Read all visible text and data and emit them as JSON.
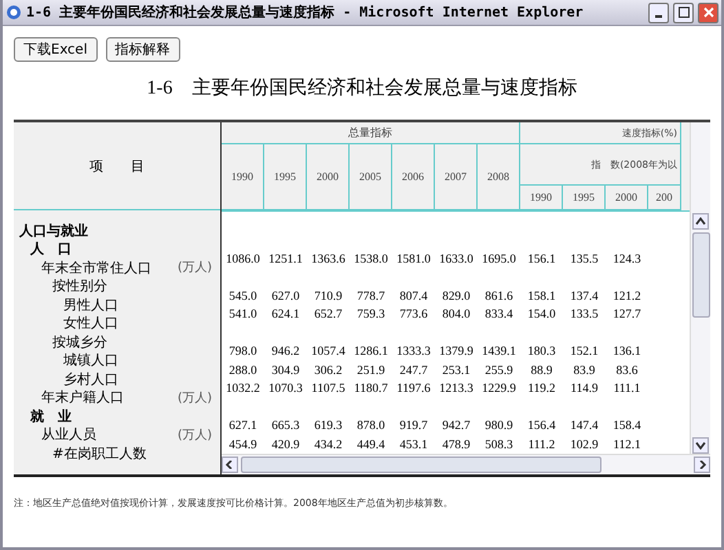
{
  "window": {
    "title": "1-6 主要年份国民经济和社会发展总量与速度指标 - Microsoft Internet Explorer"
  },
  "toolbar": {
    "buttons": [
      "下载Excel",
      "指标解释"
    ]
  },
  "page_title": "1-6　主要年份国民经济和社会发展总量与速度指标",
  "table": {
    "label_header": "项　　目",
    "total_header": "总量指标",
    "speed_header": "速度指标(%)",
    "index_header": "指　数(2008年为以",
    "total_years": [
      "1990",
      "1995",
      "2000",
      "2005",
      "2006",
      "2007",
      "2008"
    ],
    "speed_years": [
      "1990",
      "1995",
      "2000",
      "200"
    ],
    "rows": [
      {
        "label": "人口与就业",
        "children": [
          {
            "label": "人　口",
            "children": [
              {
                "label": "年末全市常住人口",
                "unit": "(万人)",
                "values": [
                  "1086.0",
                  "1251.1",
                  "1363.6",
                  "1538.0",
                  "1581.0",
                  "1633.0",
                  "1695.0",
                  "156.1",
                  "135.5",
                  "124.3"
                ],
                "children": [
                  {
                    "label": "按性别分",
                    "children": [
                      {
                        "label": "男性人口",
                        "values": [
                          "545.0",
                          "627.0",
                          "710.9",
                          "778.7",
                          "807.4",
                          "829.0",
                          "861.6",
                          "158.1",
                          "137.4",
                          "121.2"
                        ]
                      },
                      {
                        "label": "女性人口",
                        "values": [
                          "541.0",
                          "624.1",
                          "652.7",
                          "759.3",
                          "773.6",
                          "804.0",
                          "833.4",
                          "154.0",
                          "133.5",
                          "127.7"
                        ]
                      }
                    ]
                  },
                  {
                    "label": "按城乡分",
                    "children": [
                      {
                        "label": "城镇人口",
                        "values": [
                          "798.0",
                          "946.2",
                          "1057.4",
                          "1286.1",
                          "1333.3",
                          "1379.9",
                          "1439.1",
                          "180.3",
                          "152.1",
                          "136.1"
                        ]
                      },
                      {
                        "label": "乡村人口",
                        "values": [
                          "288.0",
                          "304.9",
                          "306.2",
                          "251.9",
                          "247.7",
                          "253.1",
                          "255.9",
                          "88.9",
                          "83.9",
                          "83.6"
                        ]
                      }
                    ]
                  }
                ]
              },
              {
                "label": "年末户籍人口",
                "unit": "(万人)",
                "values": [
                  "1032.2",
                  "1070.3",
                  "1107.5",
                  "1180.7",
                  "1197.6",
                  "1213.3",
                  "1229.9",
                  "119.2",
                  "114.9",
                  "111.1"
                ]
              }
            ]
          },
          {
            "label": "就　业",
            "children": [
              {
                "label": "从业人员",
                "unit": "(万人)",
                "values": [
                  "627.1",
                  "665.3",
                  "619.3",
                  "878.0",
                  "919.7",
                  "942.7",
                  "980.9",
                  "156.4",
                  "147.4",
                  "158.4"
                ],
                "children": [
                  {
                    "label": "#在岗职工人数",
                    "values": [
                      "454.9",
                      "420.9",
                      "434.2",
                      "449.4",
                      "453.1",
                      "478.9",
                      "508.3",
                      "111.2",
                      "102.9",
                      "112.1"
                    ]
                  }
                ]
              }
            ]
          }
        ]
      }
    ]
  },
  "note": "注：地区生产总值绝对值按现价计算，发展速度按可比价格计算。2008年地区生产总值为初步核算数。"
}
